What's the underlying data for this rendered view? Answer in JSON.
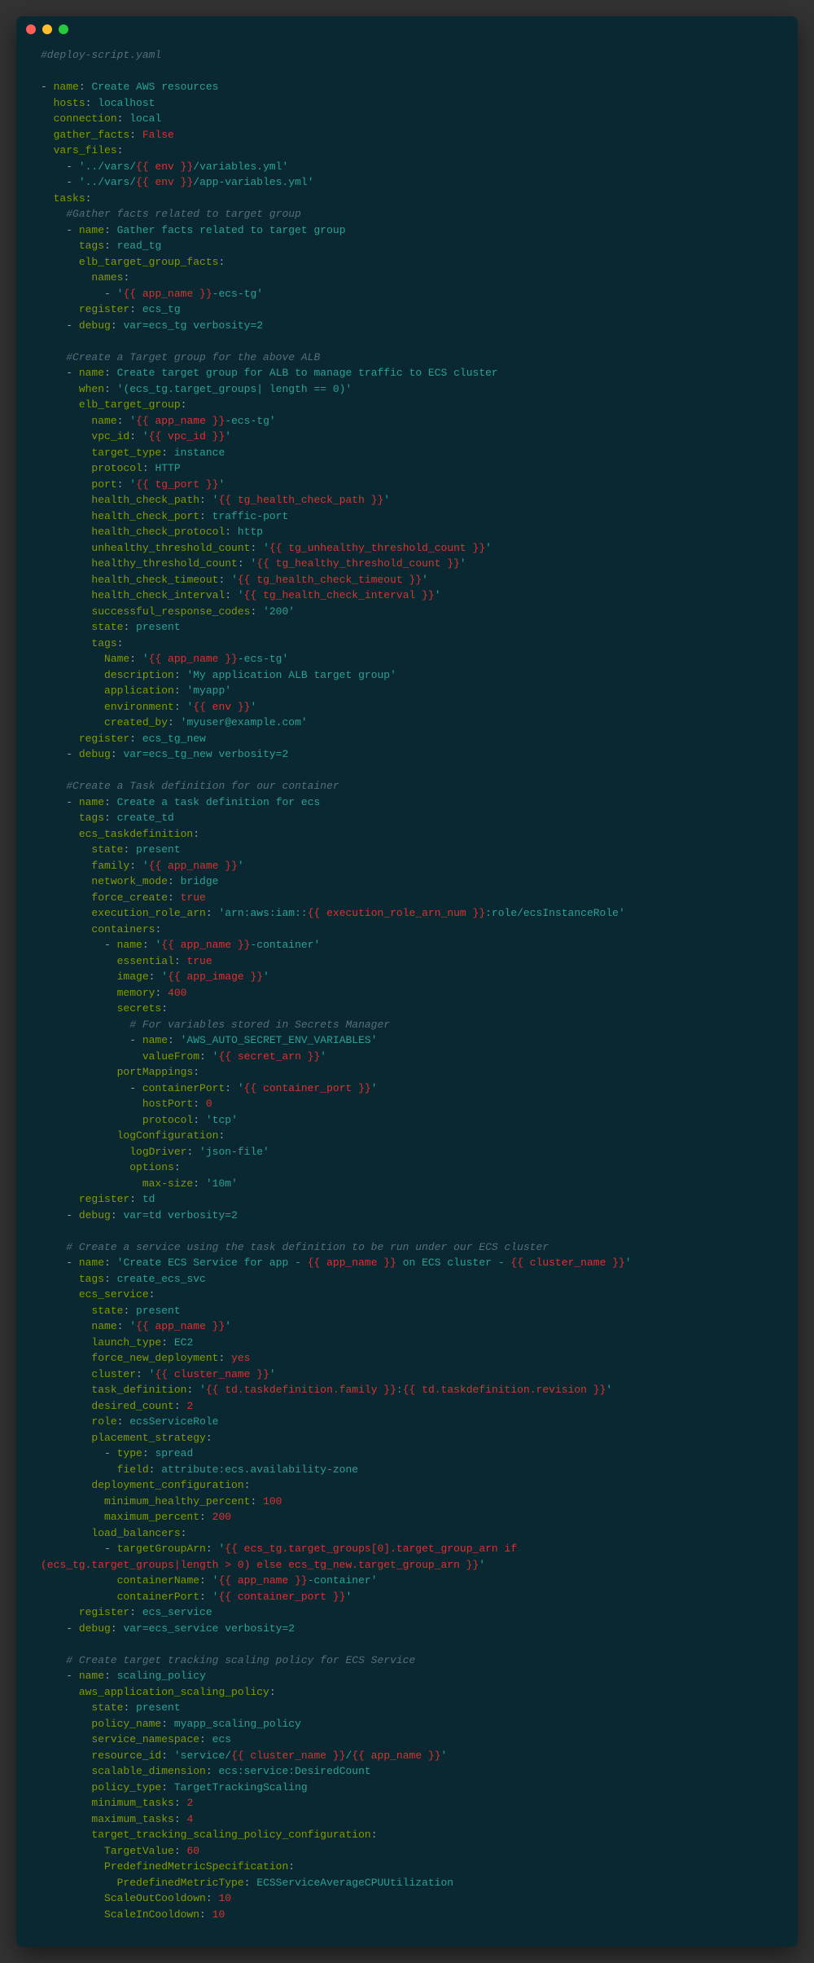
{
  "window": {
    "filename_comment": "#deploy-script.yaml"
  },
  "code": {
    "l1": "#deploy-script.yaml",
    "l3": "- name: Create AWS resources",
    "l4": "  hosts: localhost",
    "l5": "  connection: local",
    "l6": "  gather_facts: False",
    "l7": "  vars_files:",
    "l8": "    - '../vars/{{ env }}/variables.yml'",
    "l9": "    - '../vars/{{ env }}/app-variables.yml'",
    "l10": "  tasks:",
    "l11": "    #Gather facts related to target group",
    "l12": "    - name: Gather facts related to target group",
    "l13": "      tags: read_tg",
    "l14": "      elb_target_group_facts:",
    "l15": "        names:",
    "l16": "          - '{{ app_name }}-ecs-tg'",
    "l17": "      register: ecs_tg",
    "l18": "    - debug: var=ecs_tg verbosity=2",
    "l20": "    #Create a Target group for the above ALB",
    "l21": "    - name: Create target group for ALB to manage traffic to ECS cluster",
    "l22": "      when: '(ecs_tg.target_groups| length == 0)'",
    "l23": "      elb_target_group:",
    "l24": "        name: '{{ app_name }}-ecs-tg'",
    "l25": "        vpc_id: '{{ vpc_id }}'",
    "l26": "        target_type: instance",
    "l27": "        protocol: HTTP",
    "l28": "        port: '{{ tg_port }}'",
    "l29": "        health_check_path: '{{ tg_health_check_path }}'",
    "l30": "        health_check_port: traffic-port",
    "l31": "        health_check_protocol: http",
    "l32": "        unhealthy_threshold_count: '{{ tg_unhealthy_threshold_count }}'",
    "l33": "        healthy_threshold_count: '{{ tg_healthy_threshold_count }}'",
    "l34": "        health_check_timeout: '{{ tg_health_check_timeout }}'",
    "l35": "        health_check_interval: '{{ tg_health_check_interval }}'",
    "l36": "        successful_response_codes: '200'",
    "l37": "        state: present",
    "l38": "        tags:",
    "l39": "          Name: '{{ app_name }}-ecs-tg'",
    "l40": "          description: 'My application ALB target group'",
    "l41": "          application: 'myapp'",
    "l42": "          environment: '{{ env }}'",
    "l43": "          created_by: 'myuser@example.com'",
    "l44": "      register: ecs_tg_new",
    "l45": "    - debug: var=ecs_tg_new verbosity=2",
    "l47": "    #Create a Task definition for our container",
    "l48": "    - name: Create a task definition for ecs",
    "l49": "      tags: create_td",
    "l50": "      ecs_taskdefinition:",
    "l51": "        state: present",
    "l52": "        family: '{{ app_name }}'",
    "l53": "        network_mode: bridge",
    "l54": "        force_create: true",
    "l55": "        execution_role_arn: 'arn:aws:iam::{{ execution_role_arn_num }}:role/ecsInstanceRole'",
    "l56": "        containers:",
    "l57": "          - name: '{{ app_name }}-container'",
    "l58": "            essential: true",
    "l59": "            image: '{{ app_image }}'",
    "l60": "            memory: 400",
    "l61": "            secrets:",
    "l62": "              # For variables stored in Secrets Manager",
    "l63": "              - name: 'AWS_AUTO_SECRET_ENV_VARIABLES'",
    "l64": "                valueFrom: '{{ secret_arn }}'",
    "l65": "            portMappings:",
    "l66": "              - containerPort: '{{ container_port }}'",
    "l67": "                hostPort: 0",
    "l68": "                protocol: 'tcp'",
    "l69": "            logConfiguration:",
    "l70": "              logDriver: 'json-file'",
    "l71": "              options:",
    "l72": "                max-size: '10m'",
    "l73": "      register: td",
    "l74": "    - debug: var=td verbosity=2",
    "l76": "    # Create a service using the task definition to be run under our ECS cluster",
    "l77": "    - name: 'Create ECS Service for app - {{ app_name }} on ECS cluster - {{ cluster_name }}'",
    "l78": "      tags: create_ecs_svc",
    "l79": "      ecs_service:",
    "l80": "        state: present",
    "l81": "        name: '{{ app_name }}'",
    "l82": "        launch_type: EC2",
    "l83": "        force_new_deployment: yes",
    "l84": "        cluster: '{{ cluster_name }}'",
    "l85": "        task_definition: '{{ td.taskdefinition.family }}:{{ td.taskdefinition.revision }}'",
    "l86": "        desired_count: 2",
    "l87": "        role: ecsServiceRole",
    "l88": "        placement_strategy:",
    "l89": "          - type: spread",
    "l90": "            field: attribute:ecs.availability-zone",
    "l91": "        deployment_configuration:",
    "l92": "          minimum_healthy_percent: 100",
    "l93": "          maximum_percent: 200",
    "l94": "        load_balancers:",
    "l95": "          - targetGroupArn: '{{ ecs_tg.target_groups[0].target_group_arn if (ecs_tg.target_groups|length > 0) else ecs_tg_new.target_group_arn }}'",
    "l96": "            containerName: '{{ app_name }}-container'",
    "l97": "            containerPort: '{{ container_port }}'",
    "l98": "      register: ecs_service",
    "l99": "    - debug: var=ecs_service verbosity=2",
    "l101": "    # Create target tracking scaling policy for ECS Service",
    "l102": "    - name: scaling_policy",
    "l103": "      aws_application_scaling_policy:",
    "l104": "        state: present",
    "l105": "        policy_name: myapp_scaling_policy",
    "l106": "        service_namespace: ecs",
    "l107": "        resource_id: 'service/{{ cluster_name }}/{{ app_name }}'",
    "l108": "        scalable_dimension: ecs:service:DesiredCount",
    "l109": "        policy_type: TargetTrackingScaling",
    "l110": "        minimum_tasks: 2",
    "l111": "        maximum_tasks: 4",
    "l112": "        target_tracking_scaling_policy_configuration:",
    "l113": "          TargetValue: 60",
    "l114": "          PredefinedMetricSpecification:",
    "l115": "            PredefinedMetricType: ECSServiceAverageCPUUtilization",
    "l116": "          ScaleOutCooldown: 10",
    "l117": "          ScaleInCooldown: 10"
  }
}
